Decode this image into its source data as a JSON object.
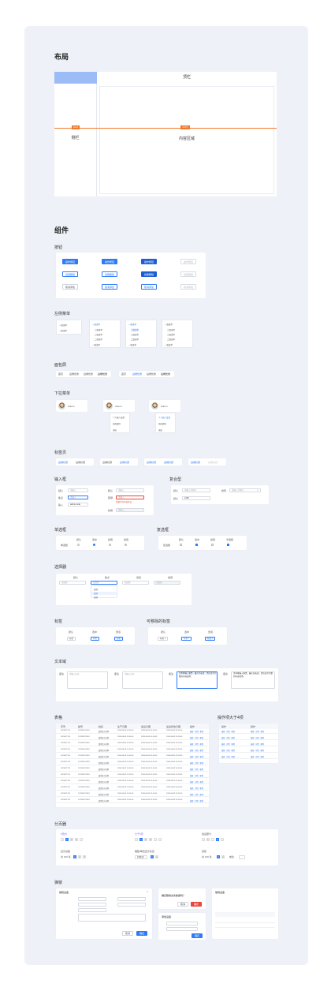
{
  "layout": {
    "title": "布局",
    "top_bar": "顶栏",
    "side_bar": "侧栏",
    "content": "内容区域",
    "fixed": "Fixed",
    "auto": "AUTO"
  },
  "components": {
    "title": "组件"
  },
  "buttons": {
    "title": "按钮",
    "rows": [
      [
        "操作按钮",
        "操作按钮",
        "操作按钮",
        "操作按钮"
      ],
      [
        "批量删除",
        "批量删除",
        "批量删除",
        "批量删除"
      ],
      [
        "取消添加",
        "取消添加",
        "取消添加",
        "取消添加"
      ]
    ]
  },
  "side_menu": {
    "title": "左侧菜单",
    "item": "一级菜单",
    "sub": "二级菜单"
  },
  "breadcrumb": {
    "title": "面包屑",
    "items": [
      "首页",
      "后端优秀",
      "后端优秀",
      "后端优秀"
    ]
  },
  "dropdown": {
    "title": "下拉菜单",
    "user": "Admin",
    "items": [
      "个人账户设置",
      "修改密码",
      "退出"
    ]
  },
  "tabs": {
    "title": "标签页",
    "tab": "后端标题"
  },
  "input": {
    "title": "输入框",
    "label_a": "默认",
    "label_b": "焦点",
    "label_c": "输入",
    "label_d": "错误",
    "label_e": "禁用",
    "placeholder": "请输入",
    "value": "admin-code",
    "error": "您填写的内容有误"
  },
  "composite": {
    "title": "复合型",
    "label": "默认",
    "label_b": "搜索",
    "placeholder": "请输入关键字",
    "value": "1238"
  },
  "radio": {
    "title": "单选框",
    "cols": [
      "默认",
      "选中",
      "禁用",
      "禁用"
    ],
    "row": "单选框"
  },
  "checkbox": {
    "title": "复选框",
    "cols": [
      "默认",
      "选中",
      "禁用",
      "半选框"
    ],
    "row": "复选框"
  },
  "select": {
    "title": "选择器",
    "cols": [
      "默认",
      "焦点",
      "激活",
      "禁用"
    ],
    "placeholder": "请选择",
    "options": [
      "选项",
      "选项",
      "选项"
    ]
  },
  "tags": {
    "title": "标签",
    "cols": [
      "默认",
      "选中",
      "激活"
    ],
    "label": "标签"
  },
  "removable": {
    "title": "可移除的标签",
    "cols": [
      "默认",
      "选中",
      "激活"
    ],
    "label": "标签"
  },
  "textarea": {
    "title": "文本域",
    "label": "备注",
    "placeholder": "请输入内容",
    "sample": "文本框输入框是，最大的长度，然后显示完整的内容使用。"
  },
  "table": {
    "title": "表格",
    "ops_title": "操作项大于4项",
    "headers": [
      "序号",
      "编号",
      "姓名",
      "生产日期",
      "最后日期",
      "最后修改日期",
      "操作"
    ],
    "row": [
      "2023071701",
      "170324071624",
      "爱测试卡名称",
      "2018-08-09 10:20:05",
      "2018-08-09 10:20:05",
      "2018-08-09 10:20:05",
      "编辑 · 详情 · 删除"
    ],
    "row_count": 12
  },
  "pagination": {
    "title": "分页器",
    "labels": [
      "5页内",
      "大于5页",
      "最后部分",
      "显示总数",
      "跳数/每页显示条目",
      "完整"
    ],
    "total": "共 100 条",
    "per_page": "10条/页",
    "goto": "前往"
  },
  "modal": {
    "title": "弹窗",
    "header": "编辑设备",
    "confirm": "确定",
    "cancel": "取消",
    "delete_q": "确定删除这条数据吗？",
    "add_header": "添加设备"
  }
}
